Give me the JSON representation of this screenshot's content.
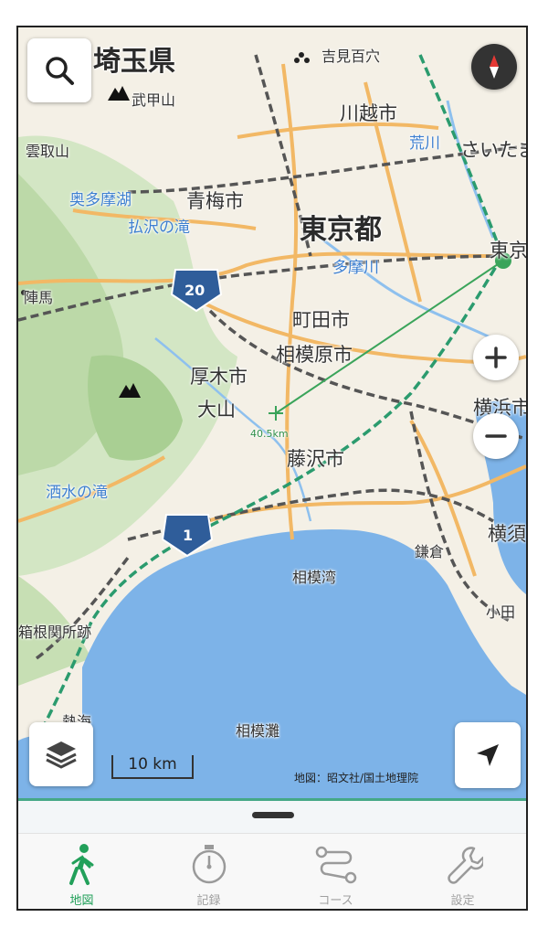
{
  "map": {
    "labels": {
      "saitama": "埼玉県",
      "tokyo": "東京都",
      "kawagoe": "川越市",
      "saitama_city": "さいたま",
      "yoshimi": "吉見百穴",
      "bukosan": "武甲山",
      "kumotori": "雲取山",
      "okutama": "奥多摩湖",
      "ome": "青梅市",
      "hossawa": "払沢の滝",
      "tamagawa": "多摩川",
      "arakawa": "荒川",
      "tokyo_station": "東京",
      "machida": "町田市",
      "sagamihara": "相模原市",
      "atsugi": "厚木市",
      "oyama": "大山",
      "fujisawa": "藤沢市",
      "yokohama": "横浜市",
      "yokosuka": "横須",
      "kamakura": "鎌倉",
      "odawara": "小田",
      "sagami_bay": "相模湾",
      "sagami_nada": "相模灘",
      "hakone": "箱根関所跡",
      "sakawa_falls": "洒水の滝",
      "atami": "熱海",
      "jinba": "陣馬",
      "route20": "20",
      "route1": "1",
      "distance": "40.5km"
    },
    "scale_label": "10 km",
    "attribution": "地図：昭文社/国土地理院"
  },
  "controls": {
    "search_icon": "search-icon",
    "compass_icon": "compass-icon",
    "zoom_in_icon": "plus-icon",
    "zoom_out_icon": "minus-icon",
    "layers_icon": "layers-icon",
    "location_icon": "location-arrow-icon"
  },
  "tabs": [
    {
      "label": "地図",
      "icon": "walker-icon",
      "active": true
    },
    {
      "label": "記録",
      "icon": "stopwatch-icon",
      "active": false
    },
    {
      "label": "コース",
      "icon": "route-icon",
      "active": false
    },
    {
      "label": "設定",
      "icon": "wrench-icon",
      "active": false
    }
  ],
  "colors": {
    "accent": "#22a05a",
    "sea": "#7db3e8",
    "land": "#f3efe6",
    "forest": "#cfe3c1"
  }
}
